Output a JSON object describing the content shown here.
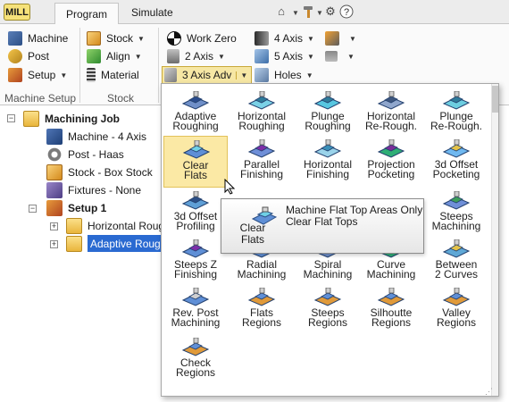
{
  "tabs": {
    "mill": "MILL",
    "program": "Program",
    "simulate": "Simulate"
  },
  "ribbon": {
    "machine_setup": {
      "machine": "Machine",
      "post": "Post",
      "setup": "Setup",
      "label": "Machine Setup"
    },
    "stock": {
      "stock": "Stock",
      "align": "Align",
      "material": "Material",
      "label": "Stock"
    },
    "toolpaths": {
      "work_zero": "Work Zero",
      "two_axis": "2 Axis",
      "three_axis_adv": "3 Axis Adv",
      "four_axis": "4 Axis",
      "five_axis": "5 Axis",
      "holes": "Holes"
    }
  },
  "tree": {
    "job": "Machining Job",
    "machine": "Machine - 4 Axis",
    "post": "Post - Haas",
    "stock": "Stock - Box Stock",
    "fixtures": "Fixtures - None",
    "setup": "Setup 1",
    "horizontal": "Horizontal Roug",
    "adaptive": "Adaptive Rough"
  },
  "dropdown": {
    "items": [
      {
        "label": "Adaptive\nRoughing"
      },
      {
        "label": "Horizontal\nRoughing"
      },
      {
        "label": "Plunge\nRoughing"
      },
      {
        "label": "Horizontal\nRe-Rough."
      },
      {
        "label": "Plunge\nRe-Rough."
      },
      {
        "label": "Clear\n  Flats"
      },
      {
        "label": "Parallel\nFinishing"
      },
      {
        "label": "Horizontal\nFinishing"
      },
      {
        "label": "Projection\nPocketing"
      },
      {
        "label": "3d Offset\nPocketing"
      },
      {
        "label": "3d Offset\nProfiling"
      },
      {
        "label": "Steeps\nMachining"
      },
      {
        "label": "Steeps  Z\nFinishing"
      },
      {
        "label": "Radial\nMachining"
      },
      {
        "label": "Spiral\nMachining"
      },
      {
        "label": "Curve\nMachining"
      },
      {
        "label": "Between\n2 Curves"
      },
      {
        "label": "Rev. Post\nMachining"
      },
      {
        "label": "Flats\nRegions"
      },
      {
        "label": "Steeps\nRegions"
      },
      {
        "label": "Silhoutte\nRegions"
      },
      {
        "label": "Valley\nRegions"
      },
      {
        "label": "Check\nRegions"
      }
    ]
  },
  "tooltip": {
    "name": "Clear\n   Flats",
    "description": "Machine Flat Top Areas Only\nClear Flat Tops"
  },
  "colors": {
    "selection": "#2a6ad1",
    "highlight": "#fbe9a5",
    "mill_tab": "#f6e27a"
  }
}
